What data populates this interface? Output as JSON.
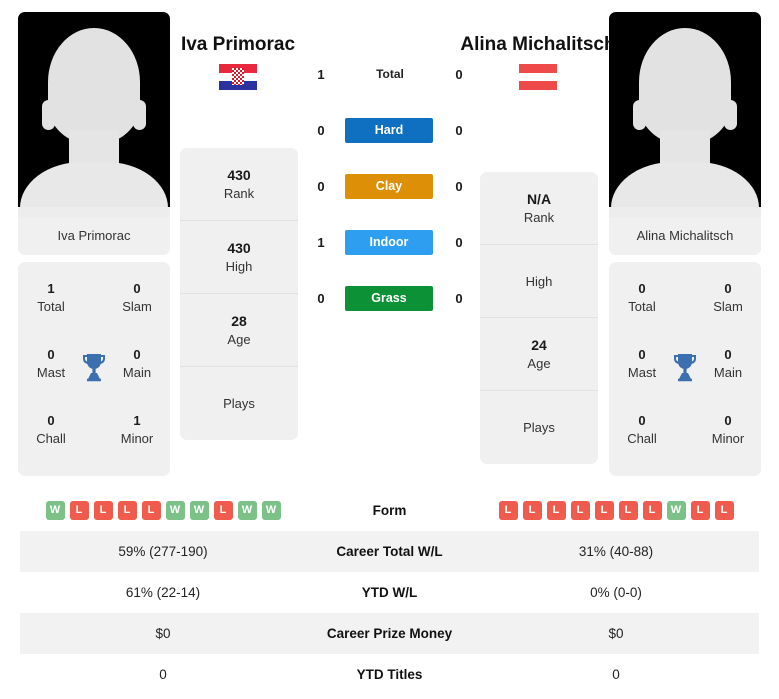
{
  "colors": {
    "win": "#7cc288",
    "loss": "#ef5b4c",
    "hard": "#0f6fc0",
    "clay": "#dd9007",
    "indoor": "#2e9ff0",
    "grass": "#0d9137",
    "trophy": "#3c6fb0",
    "card_bg": "#f0f0f0",
    "row_alt": "#f2f2f2"
  },
  "players": {
    "left": {
      "name": "Iva Primorac",
      "photo_caption": "Iva Primorac",
      "country": "Croatia",
      "flag_icon": "flag-croatia-icon",
      "flag_bands": [
        "#e8283c",
        "#ffffff",
        "#2b32a0"
      ],
      "rank": {
        "value": "430",
        "label": "Rank"
      },
      "high": {
        "value": "430",
        "label": "High"
      },
      "age": {
        "value": "28",
        "label": "Age"
      },
      "plays": {
        "value": "",
        "label": "Plays"
      },
      "titles": {
        "total": {
          "value": "1",
          "label": "Total"
        },
        "slam": {
          "value": "0",
          "label": "Slam"
        },
        "mast": {
          "value": "0",
          "label": "Mast"
        },
        "main": {
          "value": "0",
          "label": "Main"
        },
        "chall": {
          "value": "0",
          "label": "Chall"
        },
        "minor": {
          "value": "1",
          "label": "Minor"
        }
      },
      "form": [
        "W",
        "L",
        "L",
        "L",
        "L",
        "W",
        "W",
        "L",
        "W",
        "W"
      ],
      "career_total_wl": "59% (277-190)",
      "ytd_wl": "61% (22-14)",
      "career_prize_money": "$0",
      "ytd_titles": "0"
    },
    "right": {
      "name": "Alina Michalitsch",
      "photo_caption": "Alina Michalitsch",
      "country": "Austria",
      "flag_icon": "flag-austria-icon",
      "flag_bands": [
        "#ef4a4a",
        "#ffffff",
        "#ef4a4a"
      ],
      "rank": {
        "value": "N/A",
        "label": "Rank"
      },
      "high": {
        "value": "",
        "label": "High"
      },
      "age": {
        "value": "24",
        "label": "Age"
      },
      "plays": {
        "value": "",
        "label": "Plays"
      },
      "titles": {
        "total": {
          "value": "0",
          "label": "Total"
        },
        "slam": {
          "value": "0",
          "label": "Slam"
        },
        "mast": {
          "value": "0",
          "label": "Mast"
        },
        "main": {
          "value": "0",
          "label": "Main"
        },
        "chall": {
          "value": "0",
          "label": "Chall"
        },
        "minor": {
          "value": "0",
          "label": "Minor"
        }
      },
      "form": [
        "L",
        "L",
        "L",
        "L",
        "L",
        "L",
        "L",
        "W",
        "L",
        "L"
      ],
      "career_total_wl": "31% (40-88)",
      "ytd_wl": "0% (0-0)",
      "career_prize_money": "$0",
      "ytd_titles": "0"
    }
  },
  "surfaces": [
    {
      "key": "total",
      "label": "Total",
      "left": "1",
      "right": "0",
      "badge": false,
      "color": ""
    },
    {
      "key": "hard",
      "label": "Hard",
      "left": "0",
      "right": "0",
      "badge": true,
      "color": "#0f6fc0"
    },
    {
      "key": "clay",
      "label": "Clay",
      "left": "0",
      "right": "0",
      "badge": true,
      "color": "#dd9007"
    },
    {
      "key": "indoor",
      "label": "Indoor",
      "left": "1",
      "right": "0",
      "badge": true,
      "color": "#2e9ff0"
    },
    {
      "key": "grass",
      "label": "Grass",
      "left": "0",
      "right": "0",
      "badge": true,
      "color": "#0d9137"
    }
  ],
  "table": {
    "rows": [
      {
        "key": "form",
        "label": "Form"
      },
      {
        "key": "career_total_wl",
        "label": "Career Total W/L"
      },
      {
        "key": "ytd_wl",
        "label": "YTD W/L"
      },
      {
        "key": "career_prize_money",
        "label": "Career Prize Money"
      },
      {
        "key": "ytd_titles",
        "label": "YTD Titles"
      }
    ]
  }
}
